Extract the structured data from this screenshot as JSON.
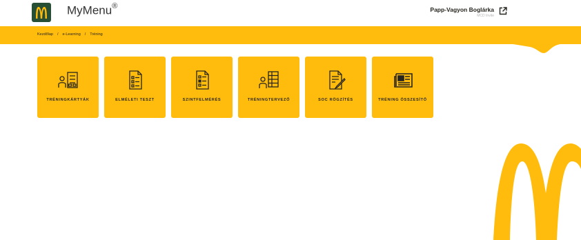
{
  "header": {
    "app_title": "MyMenu",
    "registered_mark": "®",
    "user_name": "Papp-Vagyon Boglárka",
    "user_role": "MCD Invite"
  },
  "breadcrumb": {
    "items": [
      "Kezdőlap",
      "e-Learning",
      "Tréning"
    ],
    "separator": "/"
  },
  "tiles": [
    {
      "label": "Tréningkártyák",
      "icon": "person-checklist-icon"
    },
    {
      "label": "Elméleti teszt",
      "icon": "document-list-icon"
    },
    {
      "label": "Szintfelmérés",
      "icon": "document-checklist-icon"
    },
    {
      "label": "Tréningtervező",
      "icon": "person-table-icon"
    },
    {
      "label": "SOC rögzítés",
      "icon": "document-pen-icon"
    },
    {
      "label": "Tréning összesítő",
      "icon": "newspaper-icon"
    }
  ],
  "colors": {
    "brand_yellow": "#ffbc0d",
    "brand_green": "#264f36",
    "text_dark": "#27251f"
  }
}
